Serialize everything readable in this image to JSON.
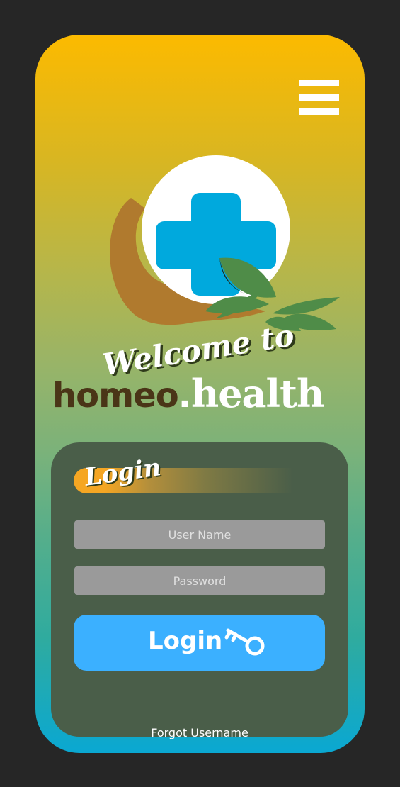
{
  "header": {
    "menu_icon": "hamburger-menu-icon"
  },
  "logo": {
    "icon": "medical-cross-hand-leaves-logo",
    "colors": {
      "cross": "#00a9dd",
      "circle": "#ffffff",
      "leaf": "#4f8c48",
      "hand": "#b07a2e"
    }
  },
  "welcome": {
    "text": "Welcome to"
  },
  "brand": {
    "part1": "homeo",
    "dot": ".",
    "part2": "health"
  },
  "login": {
    "heading": "Login",
    "username_placeholder": "User Name",
    "password_placeholder": "Password",
    "button_label": "Login",
    "button_icon": "key-icon",
    "forgot_link": "Forgot Username"
  },
  "colors": {
    "background": "#262626",
    "gradient_top": "#fcba00",
    "gradient_bottom": "#0aa8d2",
    "card": "#4a5e49",
    "field": "#9a9a9a",
    "button": "#3bb0ff",
    "brand_dark": "#4a3517",
    "accent_orange": "#f5a623"
  }
}
